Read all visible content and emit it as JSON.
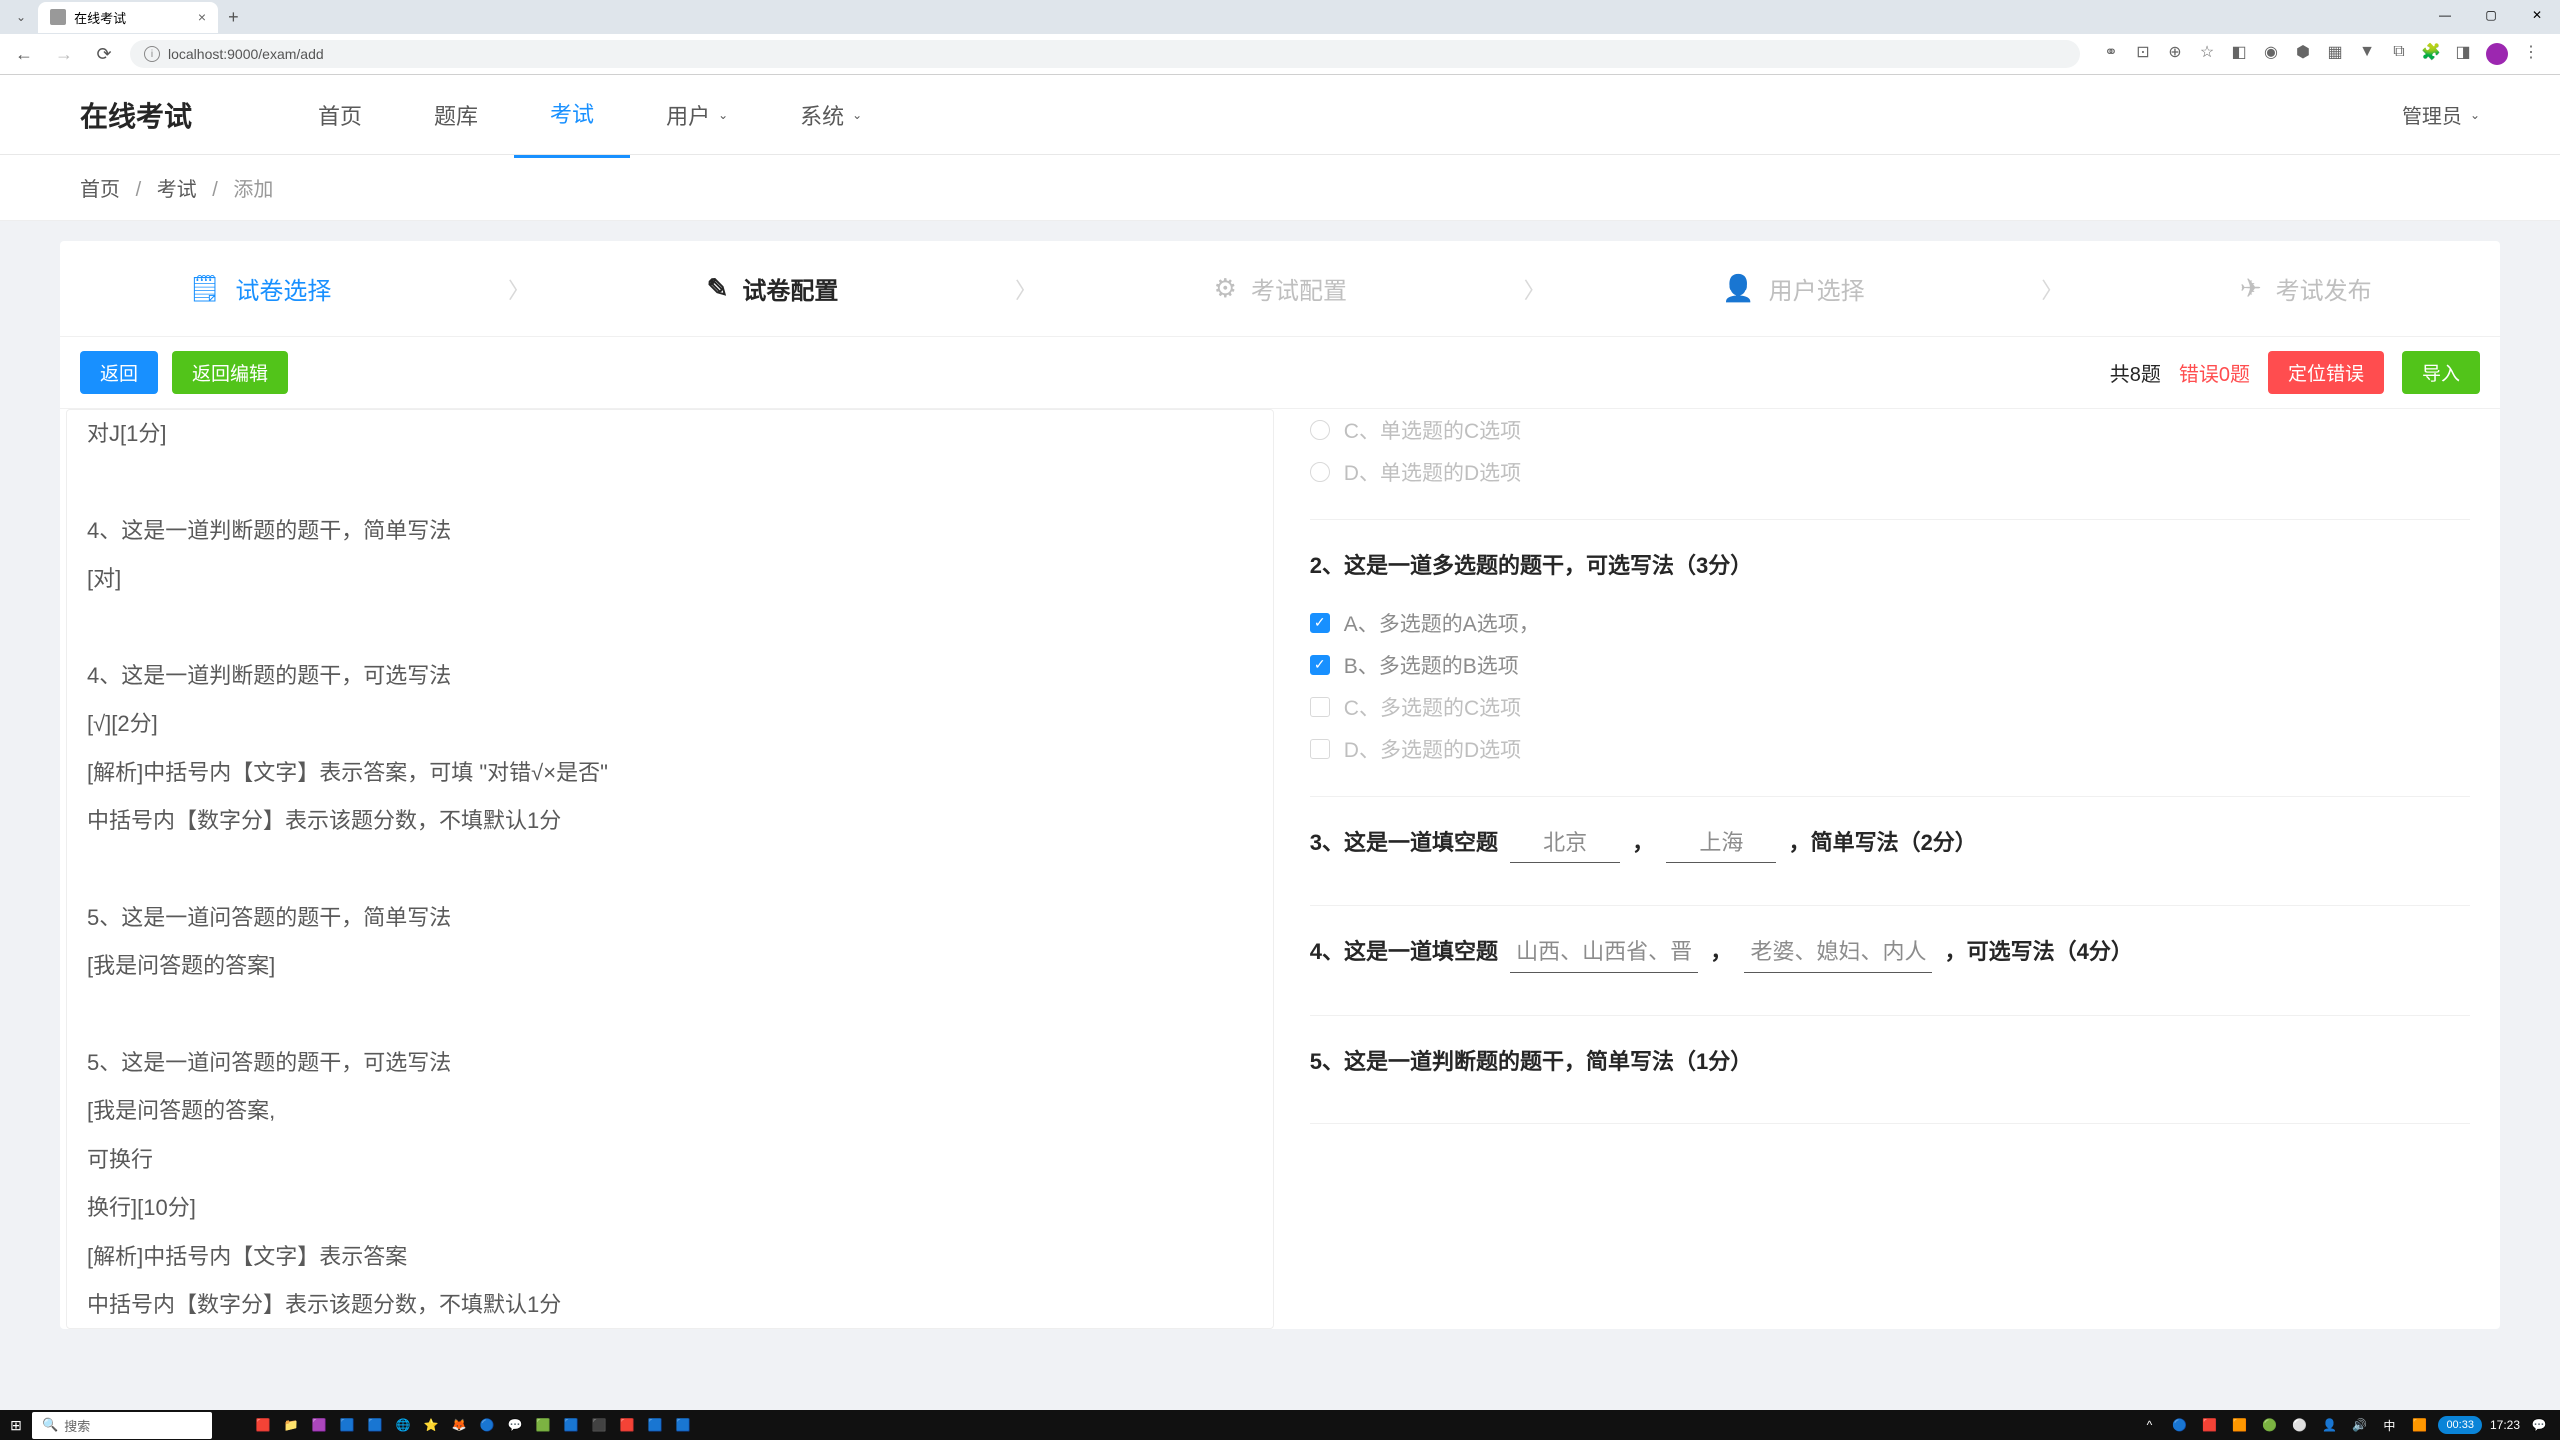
{
  "browser": {
    "tab_title": "在线考试",
    "url": "localhost:9000/exam/add",
    "window_controls": {
      "min": "—",
      "max": "▢",
      "close": "✕"
    }
  },
  "header": {
    "logo": "在线考试",
    "nav": [
      "首页",
      "题库",
      "考试",
      "用户",
      "系统"
    ],
    "active_nav": "考试",
    "user": "管理员"
  },
  "breadcrumb": {
    "items": [
      "首页",
      "考试",
      "添加"
    ]
  },
  "steps": {
    "list": [
      {
        "icon": "📋",
        "label": "试卷选择",
        "state": "done"
      },
      {
        "icon": "✎",
        "label": "试卷配置",
        "state": "active"
      },
      {
        "icon": "⚙",
        "label": "考试配置",
        "state": "pending"
      },
      {
        "icon": "👤",
        "label": "用户选择",
        "state": "pending"
      },
      {
        "icon": "✈",
        "label": "考试发布",
        "state": "pending"
      }
    ]
  },
  "toolbar": {
    "back": "返回",
    "back_edit": "返回编辑",
    "count_text": "共8题",
    "error_text": "错误0题",
    "locate": "定位错误",
    "import": "导入"
  },
  "source_text": "对J[1分]\n\n4、这是一道判断题的题干，简单写法\n[对]\n\n4、这是一道判断题的题干，可选写法\n[√][2分]\n[解析]中括号内【文字】表示答案，可填 \"对错√×是否\"\n中括号内【数字分】表示该题分数，不填默认1分\n\n5、这是一道问答题的题干，简单写法\n[我是问答题的答案]\n\n5、这是一道问答题的题干，可选写法\n[我是问答题的答案,\n可换行\n换行][10分]\n[解析]中括号内【文字】表示答案\n中括号内【数字分】表示该题分数，不填默认1分\n默认为主观题，需要人工阅卷",
  "questions": {
    "q1_opts": {
      "c": "C、单选题的C选项",
      "d": "D、单选题的D选项"
    },
    "q2": {
      "title": "2、这是一道多选题的题干，可选写法（3分）",
      "opts": [
        {
          "label": "A、多选题的A选项，",
          "checked": true
        },
        {
          "label": "B、多选题的B选项",
          "checked": true
        },
        {
          "label": "C、多选题的C选项",
          "checked": false
        },
        {
          "label": "D、多选题的D选项",
          "checked": false
        }
      ]
    },
    "q3": {
      "prefix": "3、这是一道填空题",
      "blank1": "北京",
      "mid": "，",
      "blank2": "上海",
      "suffix": "，简单写法（2分）"
    },
    "q4": {
      "prefix": "4、这是一道填空题",
      "blank1": "山西、山西省、晋",
      "mid": "，",
      "blank2": "老婆、媳妇、内人",
      "suffix": "，可选写法（4分）"
    },
    "q5": {
      "title": "5、这是一道判断题的题干，简单写法（1分）"
    }
  },
  "taskbar": {
    "search_placeholder": "搜索",
    "time": "17:23",
    "record": "00:33"
  }
}
